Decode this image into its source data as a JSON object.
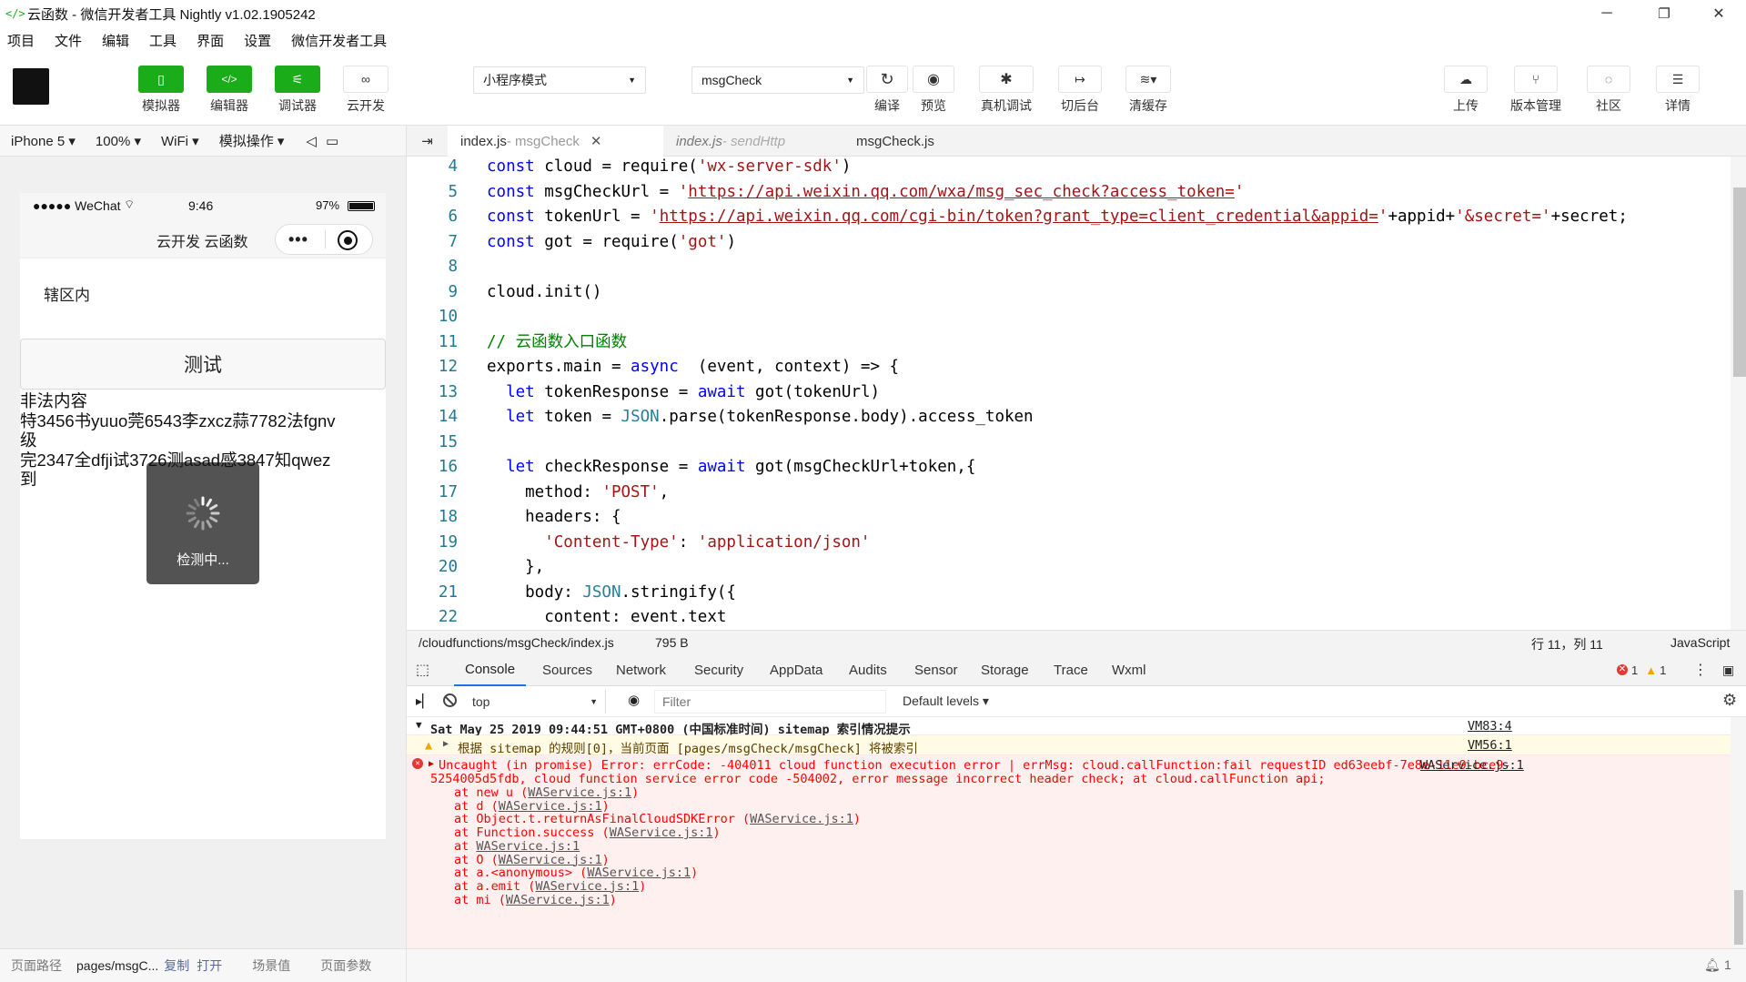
{
  "window": {
    "title": "云函数 - 微信开发者工具 Nightly v1.02.1905242",
    "logo": "</>"
  },
  "menu": [
    "项目",
    "文件",
    "编辑",
    "工具",
    "界面",
    "设置",
    "微信开发者工具"
  ],
  "toolbar": {
    "simulator": "模拟器",
    "editor": "编辑器",
    "debugger": "调试器",
    "cloud": "云开发",
    "mode": "小程序模式",
    "compile_target": "msgCheck",
    "compile": "编译",
    "preview": "预览",
    "remote_debug": "真机调试",
    "background": "切后台",
    "clear_cache": "清缓存",
    "upload": "上传",
    "version": "版本管理",
    "community": "社区",
    "details": "详情"
  },
  "sim_toolbar": {
    "device": "iPhone 5",
    "zoom": "100%",
    "network": "WiFi",
    "ops": "模拟操作"
  },
  "phone": {
    "signal": "●●●●● WeChat",
    "time": "9:46",
    "battery": "97%",
    "nav_title": "云开发 云函数",
    "area_text": "辖区内",
    "test_button": "测试",
    "result_lines": [
      "非法内容",
      "特3456书yuuo莞6543李zxcz蒜7782法fgnv",
      "级",
      "完2347全dfji试3726测asad感3847知qwez",
      "到"
    ],
    "loading": "检测中..."
  },
  "bottom_left": {
    "path_label": "页面路径",
    "path": "pages/msgC...",
    "copy": "复制",
    "open": "打开",
    "scene": "场景值",
    "params": "页面参数"
  },
  "editor": {
    "tabs": [
      {
        "name": "index.js",
        "suffix": " - msgCheck"
      },
      {
        "name": "index.js",
        "suffix": " - sendHttp"
      },
      {
        "name": "msgCheck.js",
        "suffix": ""
      }
    ],
    "status": {
      "path": "/cloudfunctions/msgCheck/index.js",
      "size": "795 B",
      "cursor": "行 11，列 11",
      "lang": "JavaScript"
    },
    "lines": [
      {
        "n": "4",
        "parts": [
          [
            "kw",
            "const"
          ],
          [
            "",
            "cloud = require("
          ],
          [
            "st",
            "'wx-server-sdk'"
          ],
          [
            "",
            ")"
          ]
        ]
      },
      {
        "n": "5",
        "parts": [
          [
            "kw",
            "const"
          ],
          [
            "",
            "msgCheckUrl = "
          ],
          [
            "st",
            "'"
          ],
          [
            "url",
            "https://api.weixin.qq.com/wxa/msg_sec_check?access_token="
          ],
          [
            "st",
            "'"
          ]
        ]
      },
      {
        "n": "6",
        "parts": [
          [
            "kw",
            "const"
          ],
          [
            "",
            "tokenUrl = "
          ],
          [
            "st",
            "'"
          ],
          [
            "url",
            "https://api.weixin.qq.com/cgi-bin/token?grant_type=client_credential&appid="
          ],
          [
            "st",
            "'"
          ],
          [
            "",
            "+appid+"
          ],
          [
            "st",
            "'&secret='"
          ],
          [
            "",
            "+secret;"
          ]
        ]
      },
      {
        "n": "7",
        "parts": [
          [
            "kw",
            "const"
          ],
          [
            "",
            "got = require("
          ],
          [
            "st",
            "'got'"
          ],
          [
            "",
            ")"
          ]
        ]
      },
      {
        "n": "8",
        "parts": []
      },
      {
        "n": "9",
        "parts": [
          [
            "",
            "cloud.init()"
          ]
        ]
      },
      {
        "n": "10",
        "parts": []
      },
      {
        "n": "11",
        "parts": [
          [
            "cm",
            "// 云函数入口函数"
          ]
        ]
      },
      {
        "n": "12",
        "parts": [
          [
            "",
            "exports.main = "
          ],
          [
            "kw",
            "async"
          ],
          [
            "",
            " (event, context) => {"
          ]
        ]
      },
      {
        "n": "13",
        "parts": [
          [
            "",
            "  "
          ],
          [
            "kw",
            "let"
          ],
          [
            "",
            "tokenResponse = "
          ],
          [
            "kw",
            "await"
          ],
          [
            "",
            "got(tokenUrl)"
          ]
        ]
      },
      {
        "n": "14",
        "parts": [
          [
            "",
            "  "
          ],
          [
            "kw",
            "let"
          ],
          [
            "",
            "token = "
          ],
          [
            "ty",
            "JSON"
          ],
          [
            "",
            ".parse(tokenResponse.body).access_token"
          ]
        ]
      },
      {
        "n": "15",
        "parts": []
      },
      {
        "n": "16",
        "parts": [
          [
            "",
            "  "
          ],
          [
            "kw",
            "let"
          ],
          [
            "",
            "checkResponse = "
          ],
          [
            "kw",
            "await"
          ],
          [
            "",
            "got(msgCheckUrl+token,{"
          ]
        ]
      },
      {
        "n": "17",
        "parts": [
          [
            "",
            "    method: "
          ],
          [
            "st",
            "'POST'"
          ],
          [
            "",
            ","
          ]
        ]
      },
      {
        "n": "18",
        "parts": [
          [
            "",
            "    headers: {"
          ]
        ]
      },
      {
        "n": "19",
        "parts": [
          [
            "",
            "      "
          ],
          [
            "st",
            "'Content-Type'"
          ],
          [
            "",
            ": "
          ],
          [
            "st",
            "'application/json'"
          ]
        ]
      },
      {
        "n": "20",
        "parts": [
          [
            "",
            "    },"
          ]
        ]
      },
      {
        "n": "21",
        "parts": [
          [
            "",
            "    body: "
          ],
          [
            "ty",
            "JSON"
          ],
          [
            "",
            ".stringify({"
          ]
        ]
      },
      {
        "n": "22",
        "parts": [
          [
            "",
            "      content: event.text"
          ]
        ]
      }
    ]
  },
  "devtools": {
    "tabs": [
      "Console",
      "Sources",
      "Network",
      "Security",
      "AppData",
      "Audits",
      "Sensor",
      "Storage",
      "Trace",
      "Wxml"
    ],
    "errors": "1",
    "warnings": "1",
    "context": "top",
    "filter_placeholder": "Filter",
    "levels": "Default levels"
  },
  "console": {
    "group_header": "Sat May 25 2019 09:44:51 GMT+0800 (中国标准时间) sitemap 索引情况提示",
    "group_src": "VM83:4",
    "warn_text": "根据 sitemap 的规则[0]，当前页面 [pages/msgCheck/msgCheck] 将被索引",
    "warn_src": "VM56:1",
    "error_line1": "Uncaught (in promise) Error: errCode: -404011 cloud function execution error | errMsg: cloud.callFunction:fail requestID ed63eebf-7e8e-11e9-bce9-",
    "error_line2": "5254005d5fdb, cloud function service error code -504002, error message incorrect header check; at cloud.callFunction api;",
    "error_src": "WAService.js:1",
    "stack": [
      [
        "at new u (",
        "WAService.js:1",
        ")"
      ],
      [
        "at d (",
        "WAService.js:1",
        ")"
      ],
      [
        "at Object.t.returnAsFinalCloudSDKError (",
        "WAService.js:1",
        ")"
      ],
      [
        "at Function.success (",
        "WAService.js:1",
        ")"
      ],
      [
        "at ",
        "WAService.js:1",
        ""
      ],
      [
        "at O (",
        "WAService.js:1",
        ")"
      ],
      [
        "at a.<anonymous> (",
        "WAService.js:1",
        ")"
      ],
      [
        "at a.emit (",
        "WAService.js:1",
        ")"
      ],
      [
        "at mi (",
        "WAService.js:1",
        ")"
      ]
    ]
  },
  "bottom_right": {
    "notifications": "1"
  }
}
